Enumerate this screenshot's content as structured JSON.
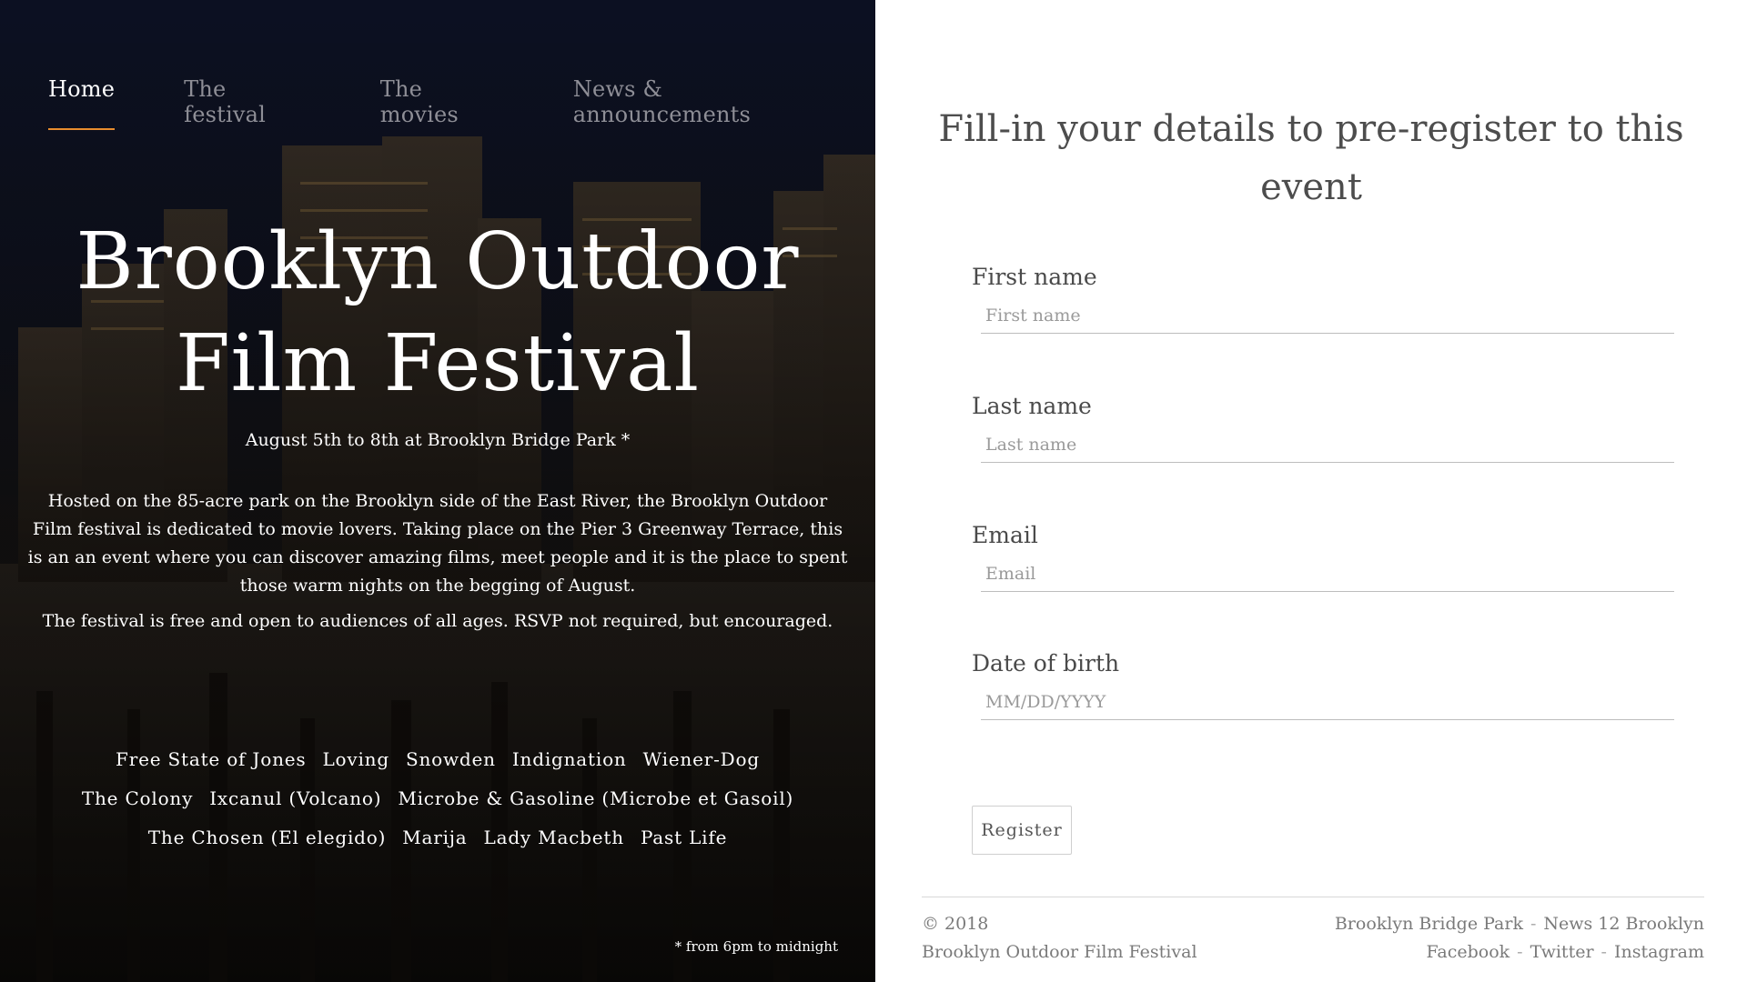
{
  "nav": {
    "items": [
      {
        "label": "Home"
      },
      {
        "label": "The festival"
      },
      {
        "label": "The movies"
      },
      {
        "label": "News & announcements"
      }
    ]
  },
  "hero": {
    "title_line1": "Brooklyn Outdoor",
    "title_line2": "Film Festival",
    "dates": "August 5th to 8th at Brooklyn Bridge Park *",
    "description": "Hosted on the 85-acre park on the Brooklyn side of the East River, the Brooklyn Outdoor Film festival is dedicated to movie lovers. Taking place on the Pier 3 Greenway Terrace, this is an an event where you can discover amazing films, meet people and it is the place to spent those warm nights on the begging of August.",
    "free_note": "The festival is free and open to audiences of all ages. RSVP not required, but encouraged.",
    "movies": [
      "Free State of Jones",
      "Loving",
      "Snowden",
      "Indignation",
      "Wiener-Dog",
      "The Colony",
      "Ixcanul (Volcano)",
      "Microbe & Gasoline (Microbe et Gasoil)",
      "The Chosen (El elegido)",
      "Marija",
      "Lady Macbeth",
      "Past Life"
    ],
    "footnote": "* from 6pm to midnight"
  },
  "form": {
    "title": "Fill-in your details to pre-register to this event",
    "fields": [
      {
        "label": "First name",
        "placeholder": "First name",
        "value": ""
      },
      {
        "label": "Last name",
        "placeholder": "Last name",
        "value": ""
      },
      {
        "label": "Email",
        "placeholder": "Email",
        "value": ""
      },
      {
        "label": "Date of birth",
        "placeholder": "MM/DD/YYYY",
        "value": ""
      }
    ],
    "submit_label": "Register"
  },
  "footer": {
    "copyright": "© 2018",
    "org": "Brooklyn Outdoor Film Festival",
    "links_row1": [
      "Brooklyn Bridge Park",
      "News 12 Brooklyn"
    ],
    "links_row2": [
      "Facebook",
      "Twitter",
      "Instagram"
    ],
    "separator": "-"
  },
  "colors": {
    "nav_active_underline": "#e88c2e",
    "nav_inactive": "#8e8e96",
    "form_text": "#4a4a4a"
  }
}
